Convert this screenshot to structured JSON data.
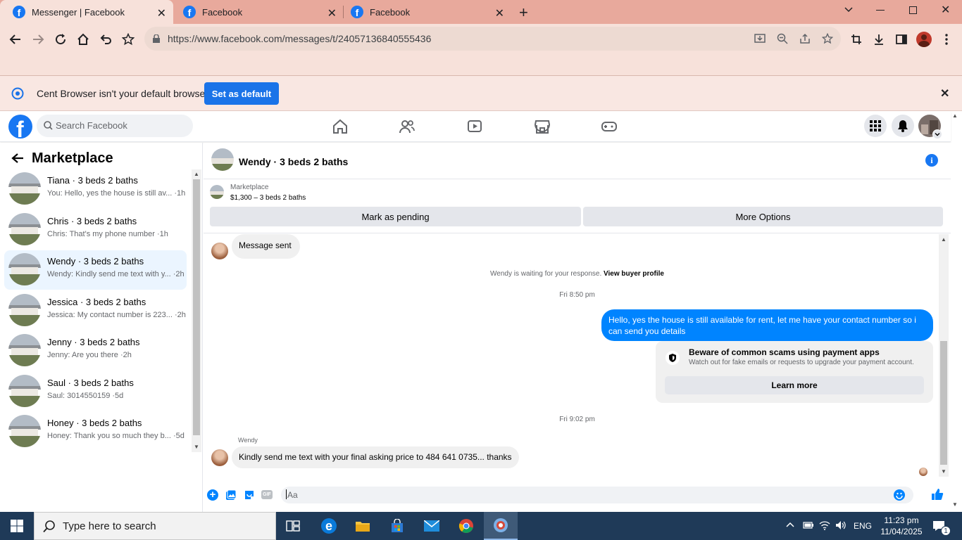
{
  "browser": {
    "tabs": [
      {
        "title": "Messenger | Facebook",
        "active": true
      },
      {
        "title": "Facebook",
        "active": false
      },
      {
        "title": "Facebook",
        "active": false
      }
    ],
    "url": "https://www.facebook.com/messages/t/24057136840555436",
    "infobar": {
      "message": "Cent Browser isn't your default browser",
      "button": "Set as default"
    }
  },
  "facebook": {
    "search_placeholder": "Search Facebook"
  },
  "sidebar": {
    "title": "Marketplace",
    "conversations": [
      {
        "name": "Tiana · 3 beds 2 baths",
        "snippet": "You: Hello, yes the house is still av... ·1h"
      },
      {
        "name": "Chris · 3 beds 2 baths",
        "snippet": "Chris: That's my phone number ·1h"
      },
      {
        "name": "Wendy · 3 beds 2 baths",
        "snippet": "Wendy: Kindly send me text with y... ·2h",
        "selected": true
      },
      {
        "name": "Jessica · 3 beds 2 baths",
        "snippet": "Jessica: My contact number is 223... ·2h"
      },
      {
        "name": "Jenny · 3 beds 2 baths",
        "snippet": "Jenny: Are you there ·2h"
      },
      {
        "name": "Saul · 3 beds 2 baths",
        "snippet": "Saul: 3014550159 ·5d"
      },
      {
        "name": "Honey · 3 beds 2 baths",
        "snippet": "Honey: Thank you so much they b... ·5d"
      }
    ]
  },
  "chat": {
    "title": "Wendy · 3 beds 2 baths",
    "listing": {
      "source": "Marketplace",
      "price": "$1,300 – 3 beds 2 baths"
    },
    "buttons": {
      "mark_pending": "Mark as pending",
      "more_options": "More Options"
    },
    "messages": {
      "sent_notice": "Message sent",
      "waiting": "Wendy is waiting for your response.",
      "view_profile": "View buyer profile",
      "time1": "Fri 8:50 pm",
      "outgoing": "Hello, yes the house is still available for rent, let me have your contact number so i can send you details",
      "warning_title": "Beware of common scams using payment apps",
      "warning_body": "Watch out for fake emails or requests to upgrade your payment account.",
      "learn_more": "Learn more",
      "time2": "Fri 9:02 pm",
      "sender": "Wendy",
      "incoming": "Kindly send me text with your final asking price to 484 641 0735... thanks"
    },
    "composer_placeholder": "Aa"
  },
  "taskbar": {
    "search_placeholder": "Type here to search",
    "lang": "ENG",
    "time": "11:23 pm",
    "date": "11/04/2025",
    "notifications": "1"
  },
  "colors": {
    "fb_blue": "#1877f2",
    "messenger_blue": "#0084ff",
    "tabbar": "#e8a99c",
    "taskbar": "#1f3a58"
  }
}
